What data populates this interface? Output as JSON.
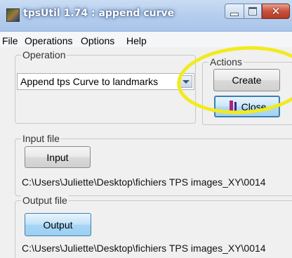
{
  "window": {
    "title": "tpsUtil 1.74 : append curve",
    "app_icon": "tpsutil-app-icon",
    "controls": {
      "minimize": "minimize-icon",
      "maximize": "maximize-icon",
      "close": "✕"
    }
  },
  "menu": {
    "items": [
      {
        "label": "File"
      },
      {
        "label": "Operations"
      },
      {
        "label": "Options"
      },
      {
        "label": "Help"
      }
    ]
  },
  "operation": {
    "group_label": "Operation",
    "selected": "Append tps Curve to landmarks"
  },
  "actions": {
    "group_label": "Actions",
    "create_label": "Create",
    "close_label_prefix": "",
    "close_label_mnemonic": "C",
    "close_label_rest": "lose"
  },
  "input_file": {
    "group_label": "Input file",
    "button_label": "Input",
    "path": "C:\\Users\\Juliette\\Desktop\\fichiers TPS images_XY\\0014"
  },
  "output_file": {
    "group_label": "Output file",
    "button_label": "Output",
    "path": "C:\\Users\\Juliette\\Desktop\\fichiers TPS images_XY\\0014"
  },
  "annotation": {
    "color": "#f2ea1e",
    "shape": "ellipse-highlight"
  }
}
